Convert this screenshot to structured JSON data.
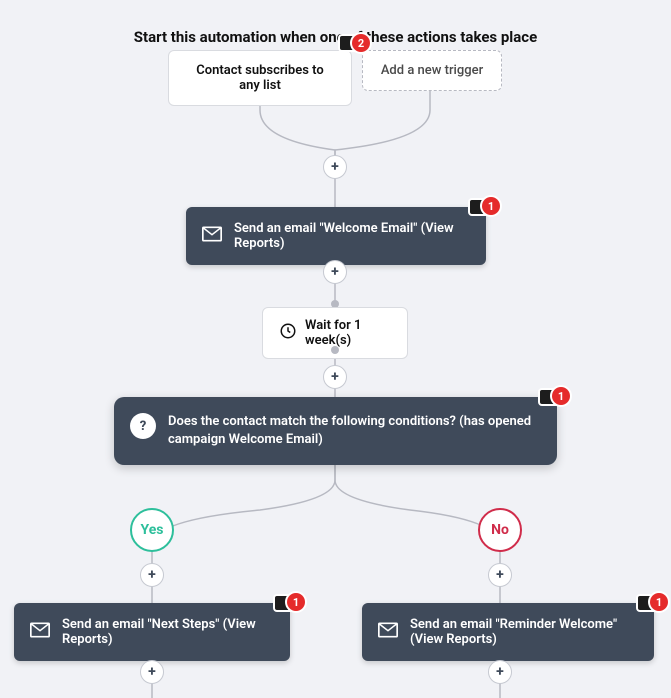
{
  "title": "Start this automation when one of these actions takes place",
  "triggers": {
    "subscribe": "Contact subscribes to any list",
    "addTrigger": "Add a new trigger",
    "badgeCount": "2"
  },
  "email1": {
    "label": "Send an email \"Welcome Email\" (View Reports)",
    "badgeCount": "1"
  },
  "wait": {
    "label": "Wait for 1 week(s)"
  },
  "condition": {
    "label": "Does the contact match the following conditions? (has opened campaign Welcome Email)",
    "badgeCount": "1"
  },
  "branches": {
    "yes": "Yes",
    "no": "No"
  },
  "emailYes": {
    "label": "Send an email \"Next Steps\" (View Reports)",
    "badgeCount": "1"
  },
  "emailNo": {
    "label": "Send an email \"Reminder Welcome\" (View Reports)",
    "badgeCount": "1"
  },
  "colors": {
    "dark": "#3f4a5a",
    "badge": "#e52b2b",
    "yes": "#2dbf9b",
    "no": "#d02c4a"
  }
}
